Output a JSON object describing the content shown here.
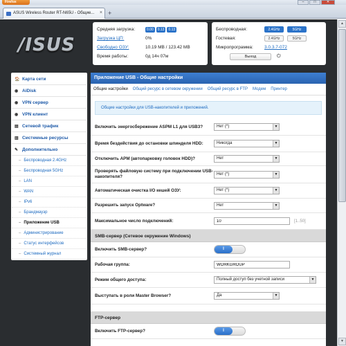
{
  "browser": {
    "app_button": "Firefox",
    "tab_title": "ASUS Wireless Router RT-N65U - Общие...",
    "new_tab": "+",
    "min": "–",
    "max": "□",
    "close": "✕"
  },
  "brand": {
    "logo": "/ISUS"
  },
  "status": {
    "cpu_load_label": "Средняя загрузка:",
    "cpu_load_values": [
      "0.00",
      "0.13",
      "0.13"
    ],
    "cpu_label": "Загрузка ЦП:",
    "cpu_value": "0%",
    "ram_label": "Свободно ОЗУ:",
    "ram_value": "10.19 MB / 123.42 MB",
    "uptime_label": "Время работы:",
    "uptime_value": "0д 14ч 07м",
    "wireless_label": "Беспроводная:",
    "wireless_bands": [
      "2.4GHz",
      "5GHz"
    ],
    "guest_label": "Гостевая:",
    "guest_bands": [
      "2.4GHz",
      "5GHz"
    ],
    "firmware_label": "Микропрограмма:",
    "firmware_value": "3.0.3.7-072",
    "exit_label": "Выход",
    "power_glyph": "⏻"
  },
  "sidebar": {
    "items": [
      {
        "label": "Карта сети",
        "icon": "🏠"
      },
      {
        "label": "AiDisk",
        "icon": "◉"
      },
      {
        "label": "VPN сервер",
        "icon": "◉"
      },
      {
        "label": "VPN клиент",
        "icon": "◉"
      },
      {
        "label": "Сетевой трафик",
        "icon": "▤"
      },
      {
        "label": "Системные ресурсы",
        "icon": "▥"
      },
      {
        "label": "Дополнительно",
        "icon": "✎"
      }
    ],
    "subitems": [
      "Беспроводная 2.4GHz",
      "Беспроводная 5GHz",
      "LAN",
      "WAN",
      "IPv6",
      "Брандмауэр",
      "Приложение USB",
      "Администрирование",
      "Статус интерфейсов",
      "Системный журнал"
    ],
    "active_sub": "Приложение USB"
  },
  "main": {
    "title": "Приложение USB - Общие настройки",
    "tabs": [
      "Общие настройки",
      "Общий ресурс в сетевом окружении",
      "Общий ресурс в FTP",
      "Модем",
      "Принтер"
    ],
    "info": "Общие настройки для USB-накопителей и приложений.",
    "rows": [
      {
        "label": "Включить энергосбережение ASPM L1 для USB3?",
        "value": "Нет (*)"
      },
      {
        "label": "Время бездействия до остановки шпинделя HDD:",
        "value": "Никогда"
      },
      {
        "label": "Отключить APM (автопарковку головок HDD)?",
        "value": "Нет"
      },
      {
        "label": "Проверять файловую систему при подключении USB-накопителя?",
        "value": "Нет (*)"
      },
      {
        "label": "Автоматическая очистка I/O кешей ОЗУ:",
        "value": "Нет (*)"
      },
      {
        "label": "Разрешить запуск Optware?",
        "value": "Нет"
      }
    ],
    "max_conn_label": "Максимальное число подключений:",
    "max_conn_value": "10",
    "max_conn_hint": "[1..50]",
    "smb_section": "SMB-сервер (Сетевое окружение Windows)",
    "smb_enable_label": "Включить SMB-сервер?",
    "toggle_on": "I",
    "workgroup_label": "Рабочая группа:",
    "workgroup_value": "WORKGROUP",
    "access_label": "Режим общего доступа:",
    "access_value": "Полный доступ без учетной записи",
    "master_label": "Выступать в роли Master Browser?",
    "master_value": "Да",
    "ftp_section": "FTP-сервер",
    "ftp_enable_label": "Включить FTP-сервер?",
    "caret": "▼"
  }
}
